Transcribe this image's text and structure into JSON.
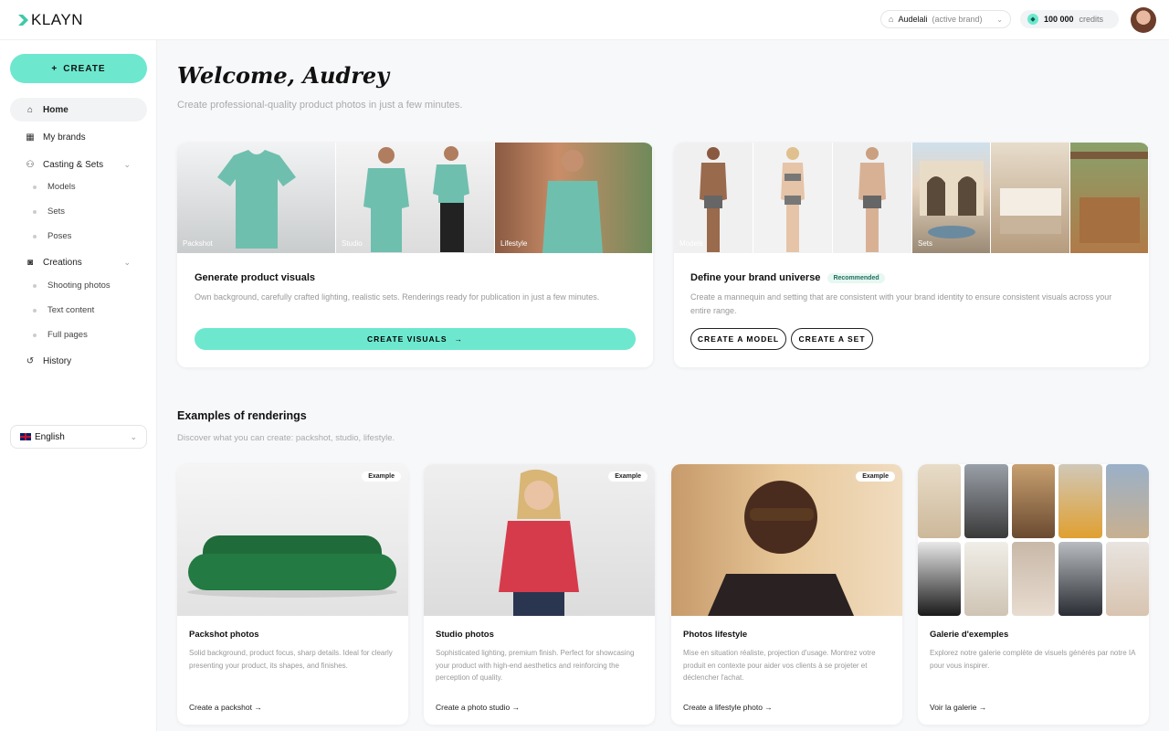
{
  "app": {
    "logo": "KLAYN"
  },
  "topbar": {
    "brand_name": "Audelali",
    "brand_suffix": "(active brand)",
    "credits_value": "100 000",
    "credits_label": "credits"
  },
  "sidebar": {
    "create_label": "CREATE",
    "items": {
      "home": "Home",
      "brands": "My brands",
      "casting": "Casting & Sets",
      "models": "Models",
      "sets": "Sets",
      "poses": "Poses",
      "creations": "Creations",
      "shooting": "Shooting photos",
      "text": "Text content",
      "pages": "Full pages",
      "history": "History"
    },
    "language": "English"
  },
  "main": {
    "welcome": "Welcome, Audrey",
    "subtitle": "Create professional-quality product photos in just a few minutes.",
    "card1": {
      "labels": [
        "Packshot",
        "Studio",
        "Lifestyle"
      ],
      "title": "Generate product visuals",
      "desc": "Own background, carefully crafted lighting, realistic sets. Renderings ready for publication in just a few minutes.",
      "cta": "CREATE VISUALS"
    },
    "card2": {
      "labels": [
        "Models",
        "Sets"
      ],
      "title": "Define your brand universe",
      "badge": "Recommended",
      "desc": "Create a mannequin and setting that are consistent with your brand identity to ensure consistent visuals across your entire range.",
      "cta_model": "CREATE A MODEL",
      "cta_set": "CREATE A SET"
    },
    "examples": {
      "title": "Examples of renderings",
      "subtitle": "Discover what you can create: packshot, studio, lifestyle.",
      "badge": "Example",
      "cards": [
        {
          "title": "Packshot photos",
          "desc": "Solid background, product focus, sharp details. Ideal for clearly presenting your product, its shapes, and finishes.",
          "link": "Create a packshot →"
        },
        {
          "title": "Studio photos",
          "desc": "Sophisticated lighting, premium finish. Perfect for showcasing your product with high-end aesthetics and reinforcing the perception of quality.",
          "link": "Create a photo studio →"
        },
        {
          "title": "Photos lifestyle",
          "desc": "Mise en situation réaliste, projection d'usage. Montrez votre produit en contexte pour aider vos clients à se projeter et déclencher l'achat.",
          "link": "Create a lifestyle photo →"
        },
        {
          "title": "Galerie d'exemples",
          "desc": "Explorez notre galerie complète de visuels générés par notre IA pour vous inspirer.",
          "link": "Voir la galerie →"
        }
      ]
    }
  },
  "colors": {
    "accent": "#6de8cf",
    "bg": "#f7f8fa"
  }
}
